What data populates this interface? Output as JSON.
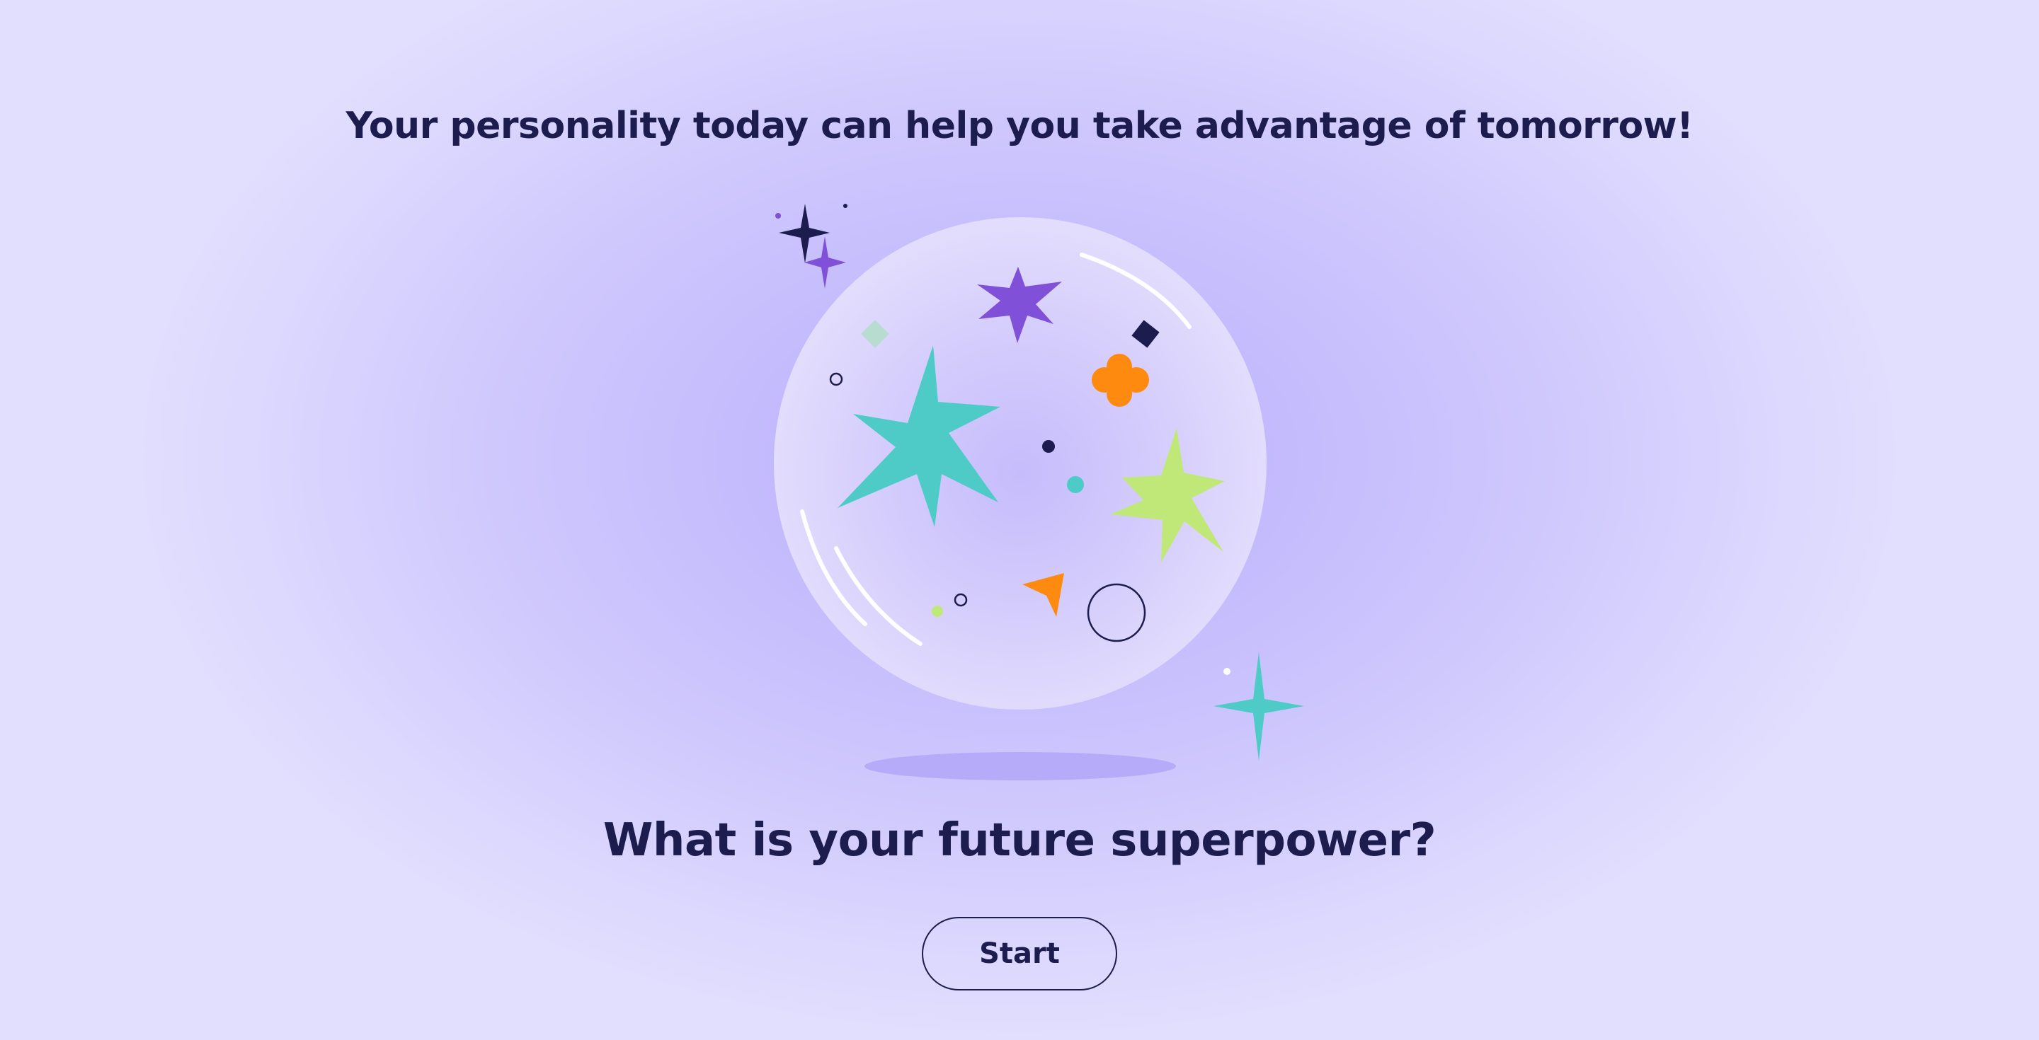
{
  "header": {
    "tagline": "Your personality today can help you take advantage of tomorrow!"
  },
  "main": {
    "question": "What is your future superpower?",
    "start_label": "Start"
  },
  "illustration": {
    "subject": "crystal-ball",
    "icons": [
      "sparkle-icon",
      "star-icon",
      "diamond-icon",
      "clover-icon",
      "cursor-arrow-icon",
      "circle-icon",
      "dot-icon"
    ]
  },
  "colors": {
    "text": "#1c1c4e",
    "teal": "#4ecbc6",
    "purple": "#8050d8",
    "lime": "#c0e878",
    "orange": "#ff8a10",
    "navy": "#1c1c4e",
    "mint": "#b8dcd0"
  }
}
